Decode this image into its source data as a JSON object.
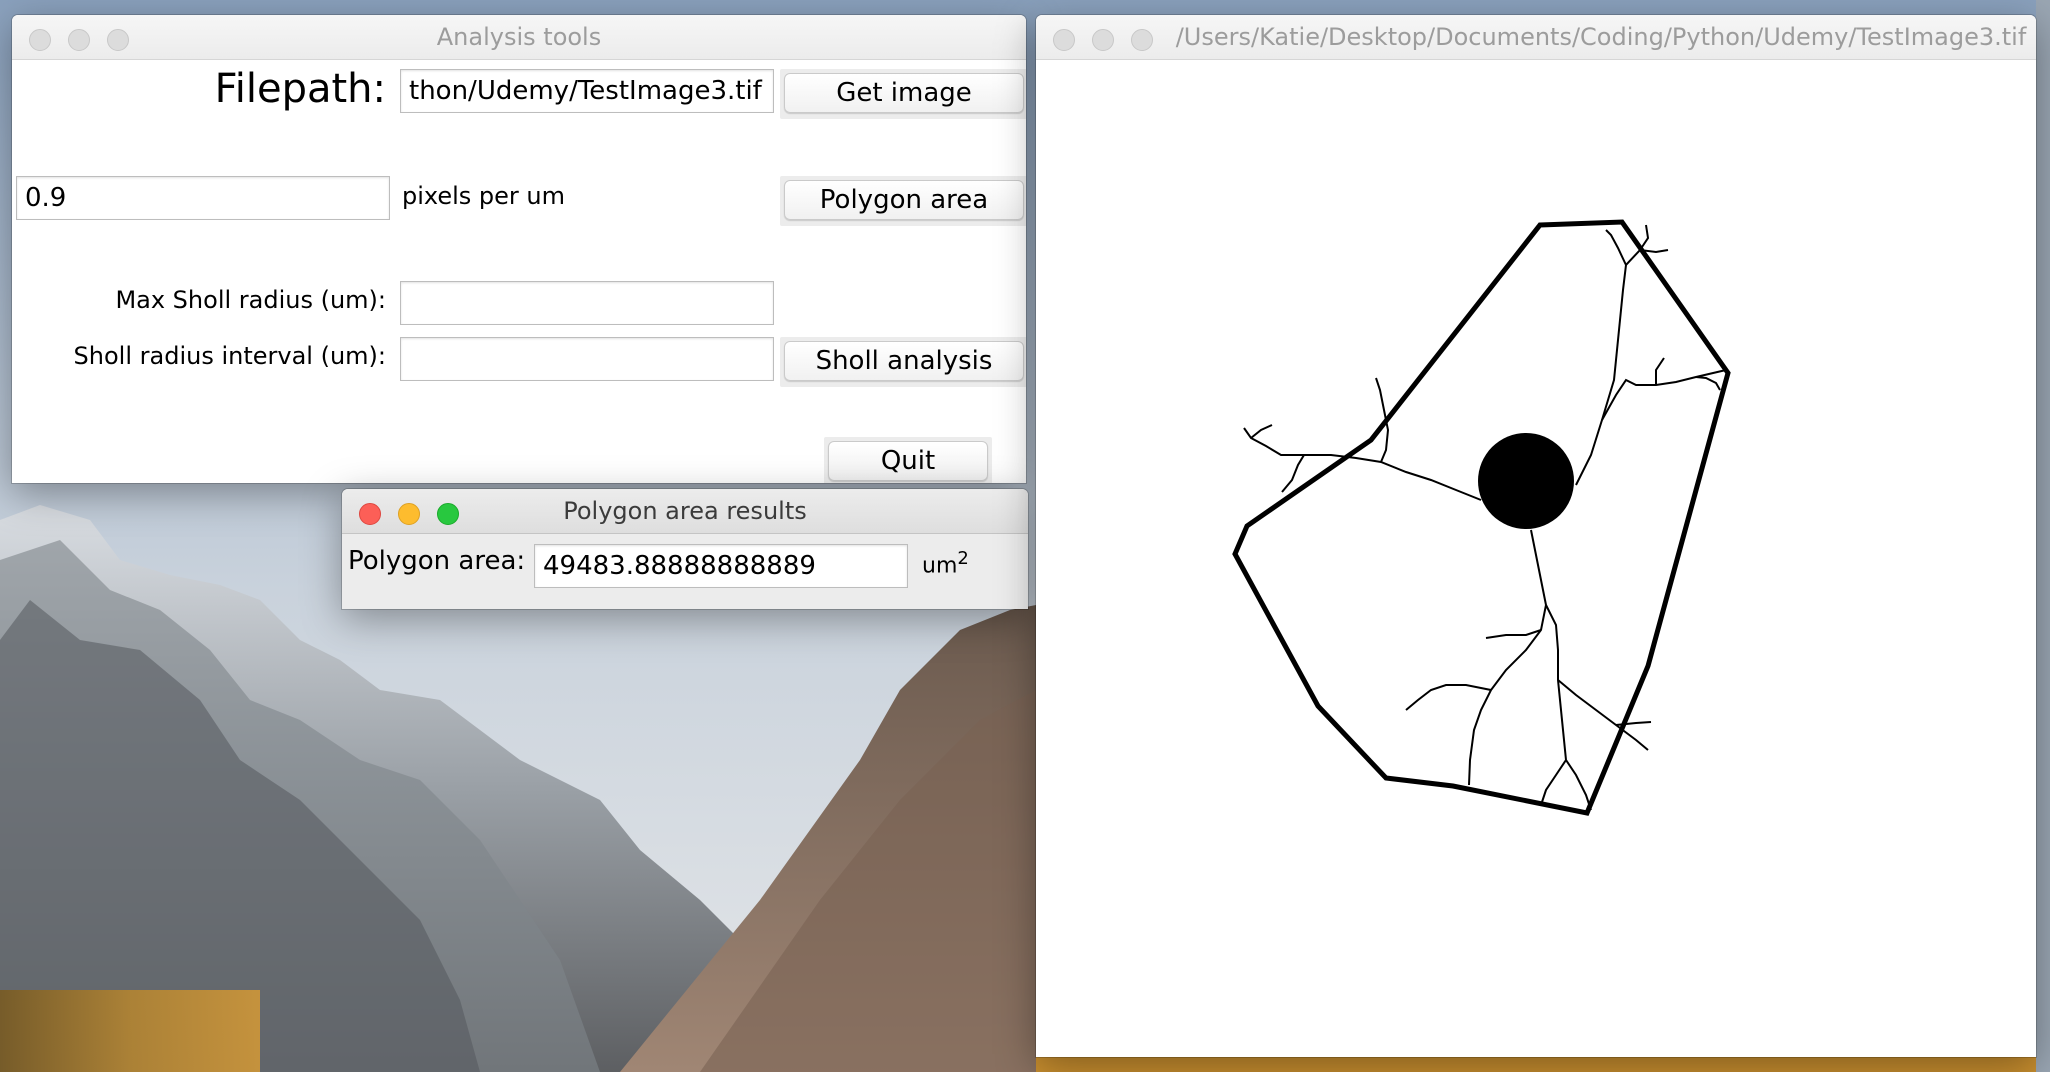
{
  "windows": {
    "tools": {
      "title": "Analysis tools",
      "filepath_label": "Filepath:",
      "filepath_value": "thon/Udemy/TestImage3.tif",
      "get_image_label": "Get image",
      "scale_value": "0.9",
      "scale_unit_label": "pixels per um",
      "polygon_area_label": "Polygon area",
      "max_radius_label": "Max Sholl radius (um):",
      "max_radius_value": "",
      "interval_label": "Sholl radius interval (um):",
      "interval_value": "",
      "sholl_label": "Sholl analysis",
      "quit_label": "Quit"
    },
    "results": {
      "title": "Polygon area results",
      "area_label": "Polygon area:",
      "area_value": "49483.88888888889",
      "unit_base": "um",
      "unit_exp": "2"
    },
    "image": {
      "title": "/Users/Katie/Desktop/Documents/Coding/Python/Udemy/TestImage3.tif"
    }
  },
  "icons": [
    "close-button",
    "minimize-button",
    "zoom-button"
  ],
  "colors": {
    "traffic_red": "#fc5f57",
    "traffic_yellow": "#fdbc2e",
    "traffic_green": "#28c83f",
    "inactive_traffic": "#dcdcdc"
  }
}
